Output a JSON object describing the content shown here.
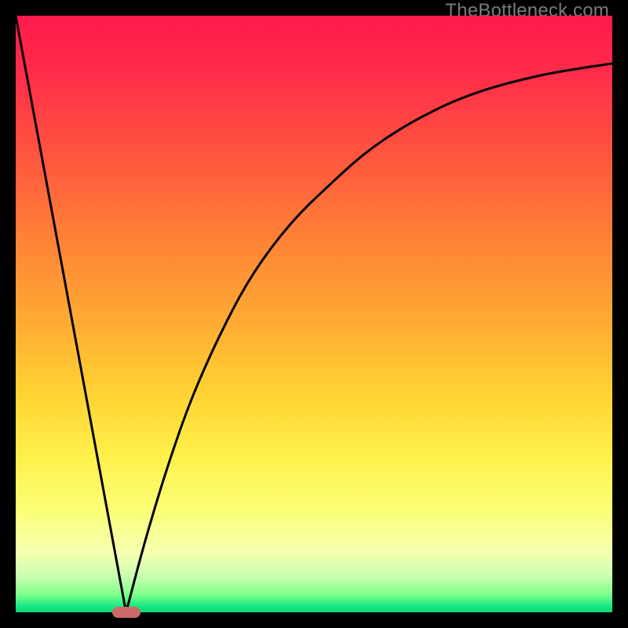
{
  "watermark": "TheBottleneck.com",
  "chart_data": {
    "type": "line",
    "title": "",
    "xlabel": "",
    "ylabel": "",
    "xlim": [
      0,
      100
    ],
    "ylim": [
      0,
      100
    ],
    "grid": false,
    "legend": false,
    "series": [
      {
        "name": "left-segment",
        "x": [
          0,
          18.5
        ],
        "values": [
          100,
          0
        ]
      },
      {
        "name": "right-segment",
        "x": [
          18.5,
          22,
          26,
          30,
          35,
          40,
          46,
          53,
          60,
          68,
          77,
          88,
          100
        ],
        "values": [
          0,
          13,
          26,
          37,
          48,
          57,
          65,
          72,
          78,
          83,
          87,
          90,
          92
        ]
      }
    ],
    "marker": {
      "x": 18.5,
      "y": 0,
      "color": "#cc6a6a"
    },
    "gradient_stops": [
      {
        "pos": 0,
        "color": "#ff1a4b"
      },
      {
        "pos": 25,
        "color": "#ff5a3d"
      },
      {
        "pos": 52,
        "color": "#ffad33"
      },
      {
        "pos": 74,
        "color": "#fff04a"
      },
      {
        "pos": 90,
        "color": "#f6ffb0"
      },
      {
        "pos": 100,
        "color": "#0ad877"
      }
    ]
  }
}
